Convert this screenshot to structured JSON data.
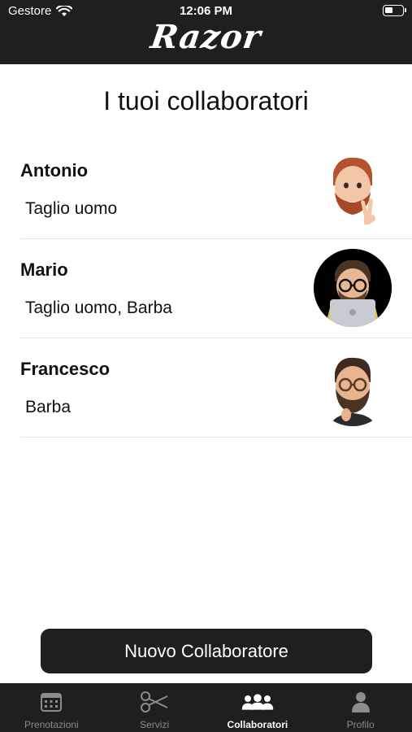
{
  "status_bar": {
    "carrier": "Gestore",
    "time": "12:06 PM"
  },
  "header": {
    "logo": "Razor"
  },
  "page": {
    "title": "I tuoi collaboratori"
  },
  "collaborators": [
    {
      "name": "Antonio",
      "services": "Taglio uomo"
    },
    {
      "name": "Mario",
      "services": "Taglio uomo, Barba"
    },
    {
      "name": "Francesco",
      "services": "Barba"
    }
  ],
  "actions": {
    "new_collaborator": "Nuovo Collaboratore"
  },
  "tabbar": {
    "items": [
      {
        "label": "Prenotazioni",
        "icon": "calendar-icon",
        "active": false
      },
      {
        "label": "Servizi",
        "icon": "scissors-icon",
        "active": false
      },
      {
        "label": "Collaboratori",
        "icon": "people-icon",
        "active": true
      },
      {
        "label": "Profilo",
        "icon": "person-icon",
        "active": false
      }
    ]
  },
  "colors": {
    "bar_background": "#1f1f1f",
    "tab_active": "#ffffff",
    "tab_inactive": "#8c8c8c"
  }
}
